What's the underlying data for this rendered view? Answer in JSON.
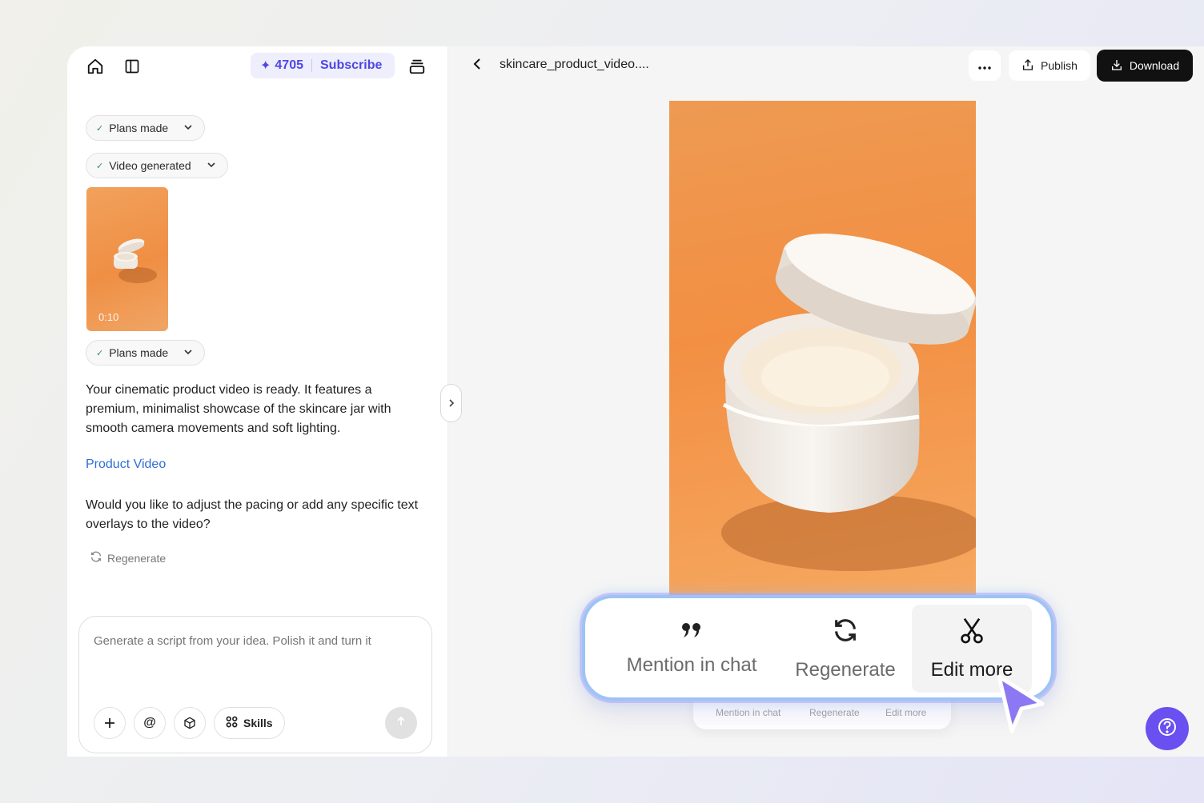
{
  "sidebar": {
    "credits": "4705",
    "subscribe_label": "Subscribe",
    "pills": [
      "Plans made",
      "Video generated",
      "Plans made"
    ],
    "thumbnail_duration": "0:10",
    "message1": "Your cinematic product video is ready. It features a premium, minimalist showcase of the skincare jar with smooth camera movements and soft lighting.",
    "link_label": "Product Video",
    "message2": "Would you like to adjust the pacing or add any specific text overlays to the video?",
    "regenerate_label": "Regenerate",
    "composer": {
      "placeholder": "Generate a script from your idea. Polish it and turn it",
      "skills_label": "Skills"
    }
  },
  "header": {
    "title": "skincare_product_video....",
    "publish_label": "Publish",
    "download_label": "Download"
  },
  "toolbar": {
    "items": [
      "Mention in chat",
      "Regenerate",
      "Edit more"
    ],
    "active": "Edit more"
  },
  "ghost_toolbar": {
    "items": [
      "Mention in chat",
      "Regenerate",
      "Edit more"
    ]
  },
  "colors": {
    "accent": "#4f46e5",
    "help_button": "#6a50f0",
    "video_bg": "#f28f43",
    "toolbar_glow": "#9cc4f6",
    "link": "#2f6fd6"
  },
  "icons": [
    "home-icon",
    "sidebar-toggle-icon",
    "sparkle-icon",
    "history-icon",
    "check-icon",
    "chevron-down-icon",
    "refresh-icon",
    "plus-icon",
    "at-icon",
    "cube-icon",
    "skills-grid-icon",
    "arrow-up-icon",
    "chevron-right-icon",
    "chevron-left-icon",
    "more-dots-icon",
    "share-icon",
    "download-icon",
    "quote-icon",
    "scissors-icon",
    "help-icon",
    "cursor-arrow-icon"
  ]
}
